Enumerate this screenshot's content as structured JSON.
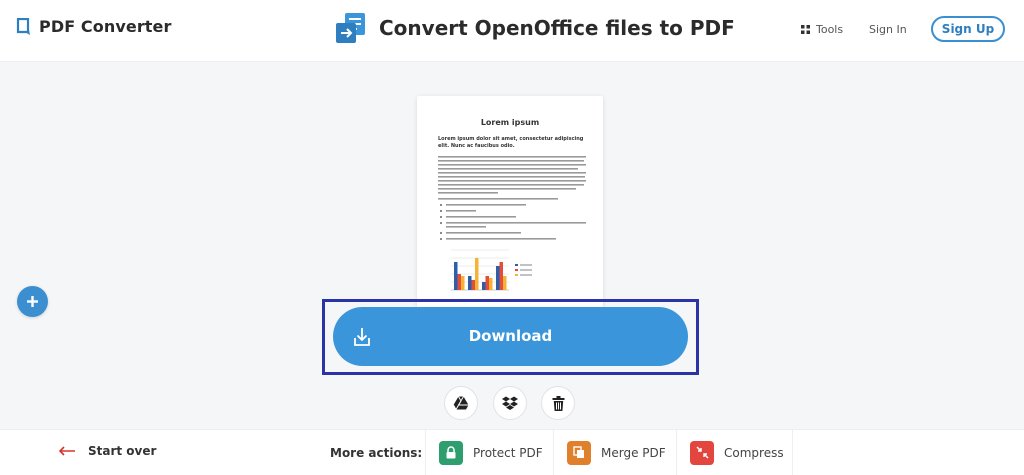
{
  "header": {
    "logo_text": "PDF Converter",
    "page_title": "Convert OpenOffice files to PDF",
    "tools_label": "Tools",
    "signin_label": "Sign In",
    "signup_label": "Sign Up"
  },
  "preview": {
    "title": "Lorem ipsum",
    "subtitle": "Lorem ipsum dolor sit amet, consectetur adipiscing elit. Nunc ac faucibus odio."
  },
  "download": {
    "label": "Download"
  },
  "cloud_actions": {
    "icons": [
      "google-drive-icon",
      "dropbox-icon",
      "trash-icon"
    ]
  },
  "footer": {
    "start_over_label": "Start over",
    "more_actions_label": "More actions:",
    "actions": [
      {
        "label": "Protect PDF",
        "color": "#2f9e6f"
      },
      {
        "label": "Merge PDF",
        "color": "#e07f2c"
      },
      {
        "label": "Compress",
        "color": "#e2463e"
      }
    ]
  },
  "colors": {
    "accent": "#3b95da",
    "highlight": "#2b33a8",
    "start_over_arrow": "#d9342b"
  }
}
